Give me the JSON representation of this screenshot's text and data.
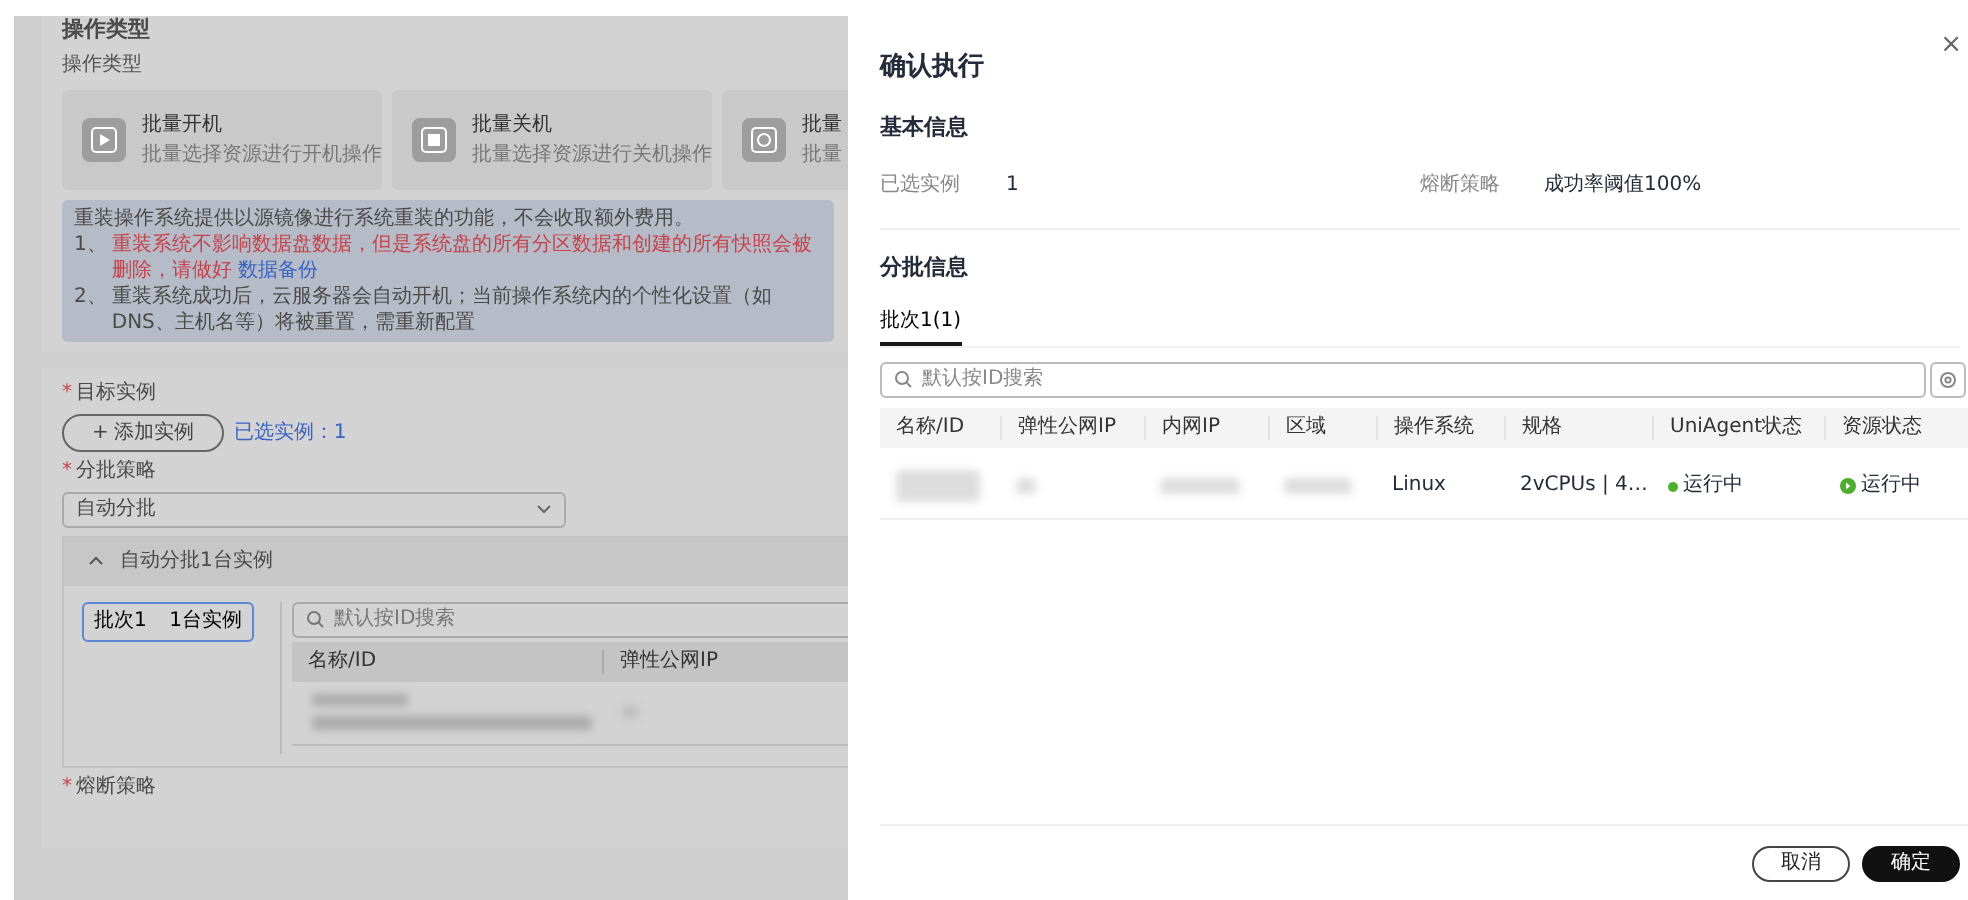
{
  "background_page": {
    "section_title": "操作类型",
    "operation_label": "操作类型",
    "operation_cards": [
      {
        "title": "批量开机",
        "description": "批量选择资源进行开机操作"
      },
      {
        "title": "批量关机",
        "description": "批量选择资源进行关机操作"
      },
      {
        "title": "批量",
        "description": "批量"
      }
    ],
    "notice": {
      "intro": "重装操作系统提供以源镜像进行系统重装的功能，不会收取额外费用。",
      "items": [
        {
          "number": "1、",
          "text": "重装系统不影响数据盘数据，但是系统盘的所有分区数据和创建的所有快照会被删除，请做好",
          "link": "数据备份",
          "warning": true
        },
        {
          "number": "2、",
          "text": "重装系统成功后，云服务器会自动开机；当前操作系统内的个性化设置（如DNS、主机名等）将被重置，需重新配置",
          "warning": false
        }
      ]
    },
    "target_label": {
      "mark": "*",
      "text": "目标实例"
    },
    "add_button": {
      "icon": "+",
      "label": "添加实例"
    },
    "selected_count": "已选实例：1",
    "batch_label": {
      "mark": "*",
      "text": "分批策略"
    },
    "batch_select": "自动分批",
    "batch_panel": {
      "title": "自动分批1台实例",
      "expanded": true,
      "batches": [
        {
          "name": "批次1",
          "count": "1台实例",
          "selected": true
        }
      ],
      "search_placeholder": "默认按ID搜索",
      "columns": [
        "名称/ID",
        "弹性公网IP"
      ]
    },
    "breaker_label": {
      "mark": "*",
      "text": "熔断策略"
    }
  },
  "drawer": {
    "title": "确认执行",
    "close": "×",
    "basic_title": "基本信息",
    "basic_fields": [
      {
        "label": "已选实例",
        "value": "1"
      },
      {
        "label": "熔断策略",
        "value": "成功率阈值100%"
      }
    ],
    "batch_title": "分批信息",
    "tabs": [
      {
        "label": "批次1(1)",
        "selected": true
      }
    ],
    "search_placeholder": "默认按ID搜索",
    "columns": [
      "名称/ID",
      "弹性公网IP",
      "内网IP",
      "区域",
      "操作系统",
      "规格",
      "UniAgent状态",
      "资源状态"
    ],
    "rows": [
      {
        "os": "Linux",
        "spec": "2vCPUs | 4…",
        "agent_status": {
          "text": "运行中",
          "color": "#4caf2b"
        },
        "resource_status": {
          "text": "运行中",
          "color": "#4caf2b"
        }
      }
    ],
    "buttons": [
      {
        "label": "取消",
        "kind": "secondary"
      },
      {
        "label": "确定",
        "kind": "primary"
      }
    ]
  }
}
